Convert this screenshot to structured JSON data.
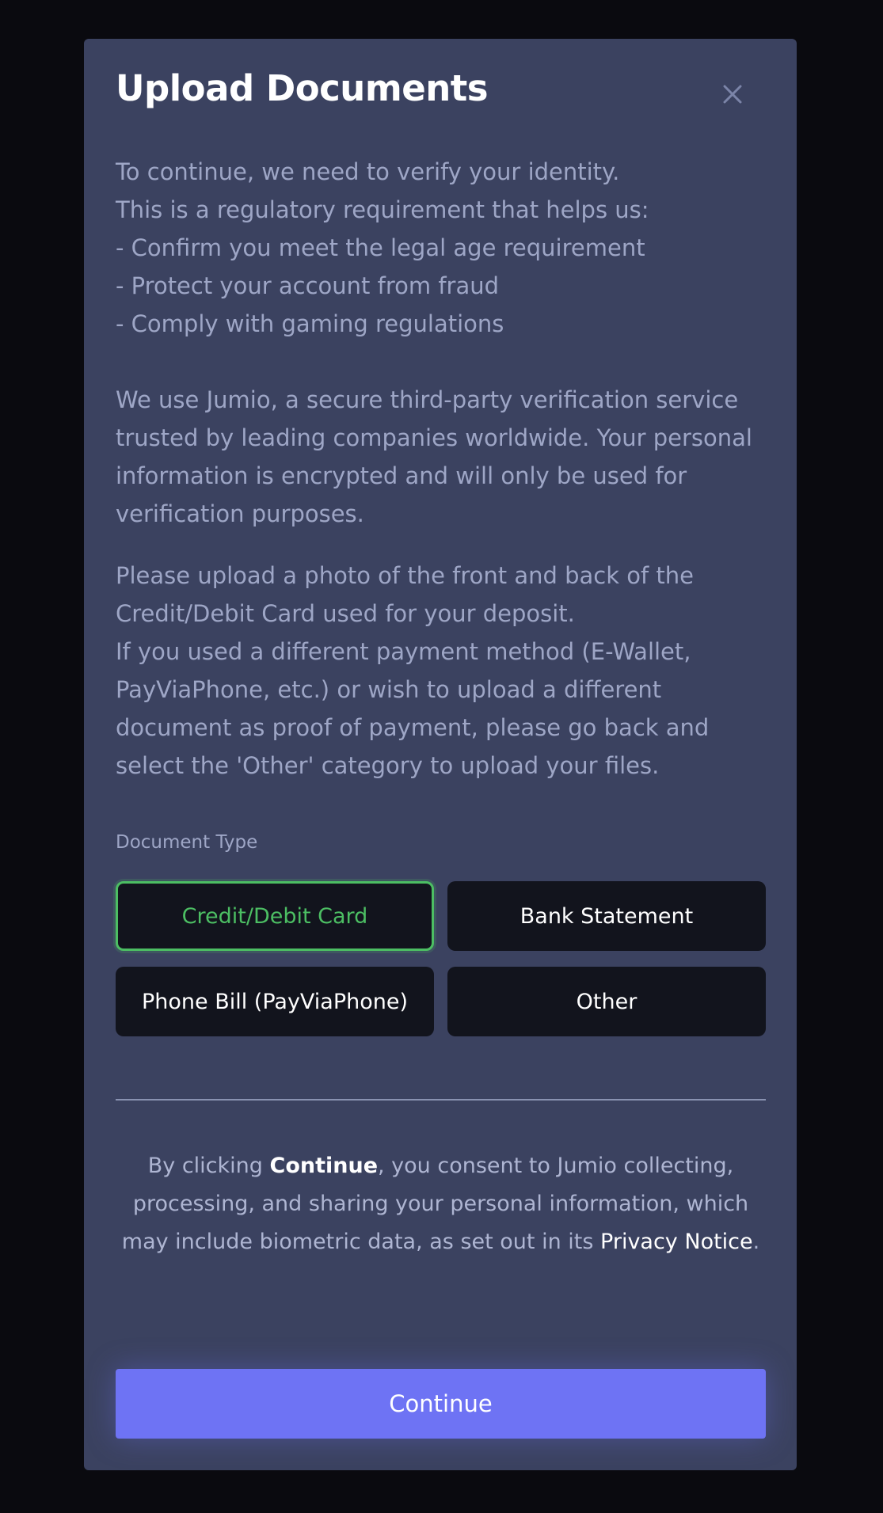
{
  "modal": {
    "title": "Upload Documents",
    "close_icon": "close-icon",
    "intro": "To continue, we need to verify your identity.\nThis is a regulatory requirement that helps us:\n- Confirm you meet the legal age requirement\n- Protect your account from fraud\n- Comply with gaming regulations",
    "jumio_info": "We use Jumio, a secure third-party verification service trusted by leading companies worldwide. Your personal information is encrypted and will only be used for verification purposes.",
    "instructions": "Please upload a photo of the front and back of the Credit/Debit Card used for your deposit.\nIf you used a different payment method (E-Wallet, PayViaPhone, etc.) or wish to upload a different document as proof of payment, please go back and select the 'Other' category to upload your files.",
    "document_type": {
      "label": "Document Type",
      "selected": "Credit/Debit Card",
      "options": [
        "Credit/Debit Card",
        "Bank Statement",
        "Phone Bill (PayViaPhone)",
        "Other"
      ]
    },
    "consent": {
      "prefix": "By clicking ",
      "bold": "Continue",
      "middle": ", you consent to Jumio collecting, processing, and sharing your personal information, which may include biometric data, as set out in its ",
      "link": "Privacy Notice",
      "suffix": "."
    },
    "continue_label": "Continue"
  },
  "colors": {
    "backdrop": "#0a0a0f",
    "modal_bg": "#3b4260",
    "body_text": "#9ea6c6",
    "option_bg": "#12141d",
    "selected_accent": "#4cbe63",
    "primary_button": "#6e73f4"
  }
}
